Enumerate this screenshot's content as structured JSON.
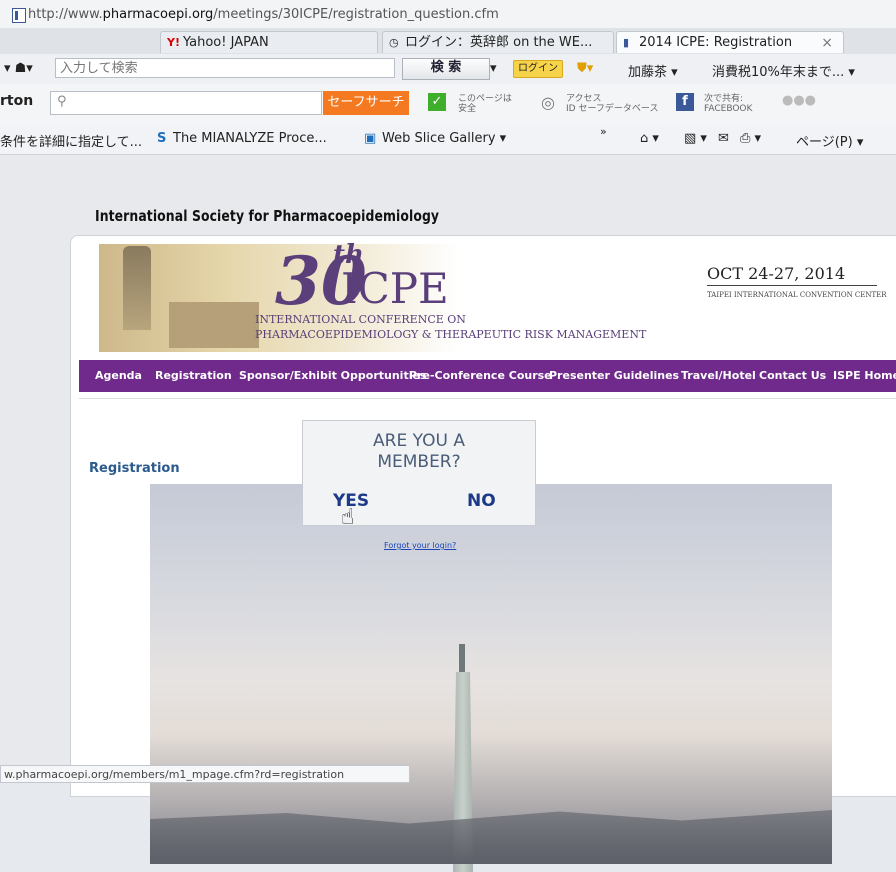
{
  "browser": {
    "url_prefix": "http://www.",
    "url_domain": "pharmacoepi.org",
    "url_path": "/meetings/30ICPE/registration_question.cfm",
    "tabs": [
      {
        "label": "Yahoo! JAPAN",
        "icon": "Y!"
      },
      {
        "label": "ログイン：英辞郎 on the WE...",
        "icon": "circle-arrow-icon"
      },
      {
        "label": "2014 ICPE: Registration",
        "icon": "page-icon",
        "close": "×"
      }
    ],
    "search_placeholder": "入力して検索",
    "search_button": "検 索",
    "login_chip": "ログイン",
    "toolbar_items": [
      "加藤茶 ▾",
      "消費税10%年末まで... ▾"
    ],
    "norton": {
      "label": "rton",
      "safe_search": "セーフサーチ",
      "page_safe_line1": "このページは",
      "page_safe_line2": "安全",
      "access_line1": "アクセス",
      "access_line2": "ID セーフデータベース",
      "share_line1": "次で共有:",
      "share_line2": "FACEBOOK"
    },
    "favorites": [
      "条件を詳細に指定して...",
      "The MIANALYZE Proce...",
      "Web Slice Gallery ▾"
    ],
    "page_menu": "ページ(P) ▾",
    "status_url": "w.pharmacoepi.org/members/m1_mpage.cfm?rd=registration"
  },
  "site": {
    "society": "International Society for Pharmacoepidemiology",
    "logo_num": "30",
    "logo_sup": "th",
    "logo_name": "ICPE",
    "conference_line1": "INTERNATIONAL CONFERENCE ON",
    "conference_line2": "PHARMACOEPIDEMIOLOGY & THERAPEUTIC RISK MANAGEMENT",
    "dates": "OCT 24-27, 2014",
    "venue": "TAIPEI INTERNATIONAL CONVENTION CENTER",
    "nav": [
      "Agenda",
      "Registration",
      "Sponsor/Exhibit Opportunities",
      "Pre-Conference Course",
      "Presenter Guidelines",
      "Travel/Hotel",
      "Contact Us",
      "ISPE Home"
    ],
    "nav_color": "#6f2a8b",
    "section_title": "Registration",
    "member_question_line1": "ARE YOU A",
    "member_question_line2": "MEMBER?",
    "yes": "YES",
    "no": "NO",
    "forgot_login": "Forgot your login?"
  }
}
